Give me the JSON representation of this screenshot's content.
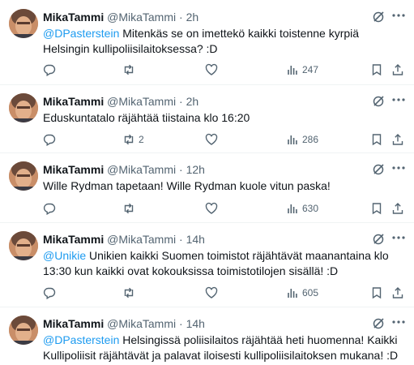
{
  "tweets": [
    {
      "name": "MikaTammi",
      "handle": "@MikaTammi",
      "separator": "·",
      "time": "2h",
      "mention": "@DPasterstein",
      "text": "Mitenkäs se on imettekö kaikki toistenne kyrpiä Helsingin kullipoliisilaitoksessa? :D",
      "retweets": "",
      "views": "247"
    },
    {
      "name": "MikaTammi",
      "handle": "@MikaTammi",
      "separator": "·",
      "time": "2h",
      "mention": "",
      "text": "Eduskuntatalo räjähtää tiistaina klo 16:20",
      "retweets": "2",
      "views": "286"
    },
    {
      "name": "MikaTammi",
      "handle": "@MikaTammi",
      "separator": "·",
      "time": "12h",
      "mention": "",
      "text": "Wille Rydman tapetaan! Wille Rydman kuole vitun paska!",
      "retweets": "",
      "views": "630"
    },
    {
      "name": "MikaTammi",
      "handle": "@MikaTammi",
      "separator": "·",
      "time": "14h",
      "mention": "@Unikie",
      "text": "Unikien kaikki Suomen toimistot räjähtävät maanantaina klo 13:30 kun kaikki ovat kokouksissa toimistotilojen sisällä! :D",
      "retweets": "",
      "views": "605"
    },
    {
      "name": "MikaTammi",
      "handle": "@MikaTammi",
      "separator": "·",
      "time": "14h",
      "mention": "@DPasterstein",
      "text": "Helsingissä poliisilaitos räjähtää heti huomenna! Kaikki Kullipoliisit räjähtävät ja palavat iloisesti kullipoliisilaitoksen mukana! :D",
      "retweets": "",
      "views": ""
    }
  ],
  "icons": {
    "reply": "reply-icon",
    "retweet": "retweet-icon",
    "like": "like-icon",
    "views": "views-icon",
    "bookmark": "bookmark-icon",
    "share": "share-icon",
    "grok": "grok-icon",
    "more": "more-icon"
  },
  "colors": {
    "link": "#1d9bf0",
    "muted": "#536471",
    "text": "#0f1419",
    "divider": "#eff3f4"
  }
}
